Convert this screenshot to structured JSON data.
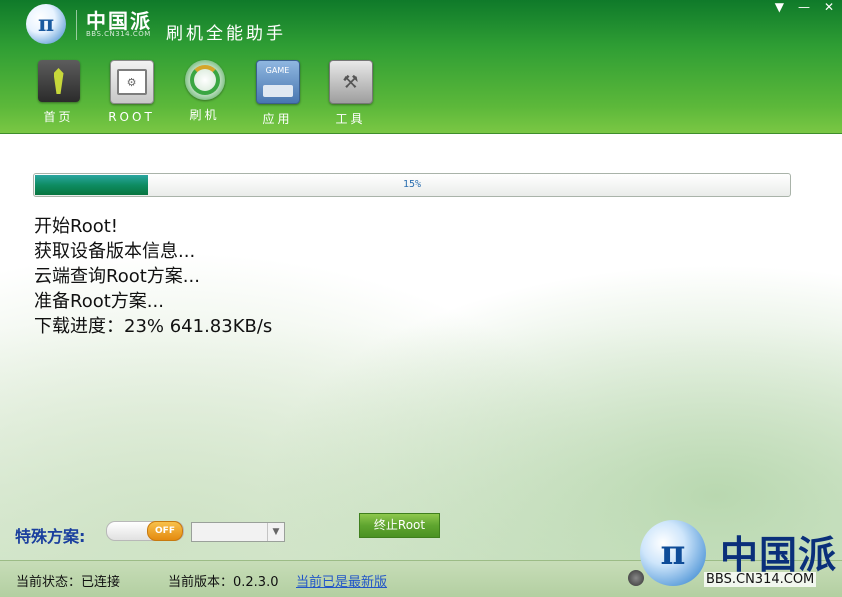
{
  "header": {
    "logo_mark": "π",
    "logo_text": "中国派",
    "logo_sub": "BBS.CN314.COM",
    "app_title": "刷机全能助手",
    "window_controls": {
      "menu": "▼",
      "minimize": "—",
      "close": "✕"
    }
  },
  "nav": {
    "items": [
      {
        "label": "首页",
        "icon": "tie-icon"
      },
      {
        "label": "ROOT",
        "icon": "window-gear-icon"
      },
      {
        "label": "刷机",
        "icon": "refresh-disc-icon"
      },
      {
        "label": "应用",
        "icon": "gamepad-icon"
      },
      {
        "label": "工具",
        "icon": "tools-icon"
      }
    ],
    "app_icon_text": "GAME"
  },
  "progress": {
    "percent": 15,
    "label": "15%"
  },
  "log": [
    "开始Root!",
    "获取设备版本信息...",
    "云端查询Root方案...",
    "准备Root方案...",
    "下载进度：23% 641.83KB/s"
  ],
  "controls": {
    "special_label": "特殊方案:",
    "toggle_state": "OFF",
    "stop_button": "终止Root"
  },
  "statusbar": {
    "state": "当前状态：已连接",
    "version": "当前版本：0.2.3.0",
    "latest_link": "当前已是最新版"
  },
  "watermark": {
    "mark": "π",
    "text": "中国派",
    "sub": "BBS.CN314.COM"
  },
  "colors": {
    "header_green": "#2f9e34",
    "progress_fill": "#0e8c62",
    "stop_button": "#5fa52f",
    "link_blue": "#2256c8"
  }
}
